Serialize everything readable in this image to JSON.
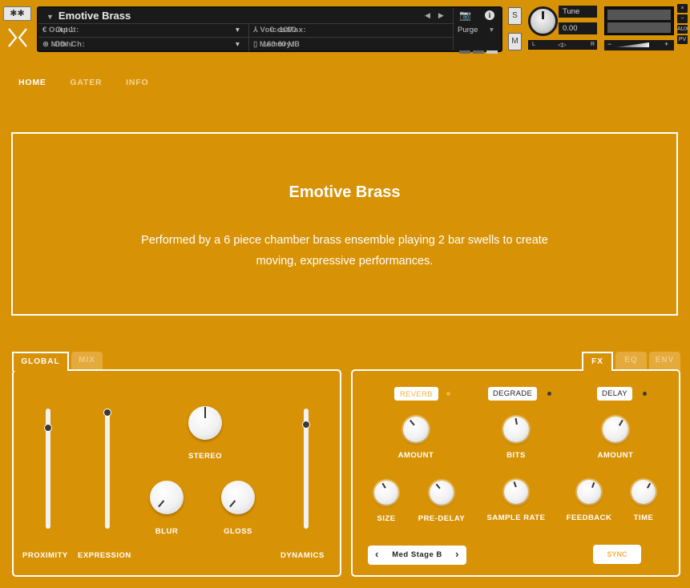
{
  "header": {
    "gear_glyph": "✱✱",
    "instrument_name": "Emotive Brass",
    "output_label": "Output:",
    "output_value": "Out 1",
    "midi_label": "MIDI Ch:",
    "midi_value": "Omni",
    "voices_label": "Voices:",
    "voices_value": "0",
    "max_label": "Max:",
    "max_value": "1000",
    "memory_label": "Memory:",
    "memory_value": "160.60 MB",
    "purge_label": "Purge",
    "solo_label": "S",
    "mute_label": "M",
    "tune_label": "Tune",
    "tune_value": "0.00",
    "pan_left": "L",
    "pan_center": "◁▷",
    "pan_right": "R",
    "vol_minus": "−",
    "vol_plus": "+",
    "side_close": "×",
    "side_min": "−",
    "side_aux": "AUX",
    "side_pv": "PV"
  },
  "nav": {
    "tabs": [
      {
        "label": "HOME",
        "active": true
      },
      {
        "label": "GATER",
        "active": false
      },
      {
        "label": "INFO",
        "active": false
      }
    ]
  },
  "info": {
    "title": "Emotive Brass",
    "description_line1": "Performed by a 6 piece chamber brass ensemble playing 2 bar swells to create",
    "description_line2": "moving, expressive performances."
  },
  "left_panel": {
    "tabs": [
      {
        "label": "GLOBAL",
        "active": true
      },
      {
        "label": "MIX",
        "active": false
      }
    ],
    "sliders": {
      "proximity": {
        "label": "PROXIMITY",
        "value": 0.84
      },
      "expression": {
        "label": "EXPRESSION",
        "value": 0.97
      },
      "dynamics": {
        "label": "DYNAMICS",
        "value": 0.87
      }
    },
    "knobs": {
      "stereo": {
        "label": "STEREO"
      },
      "blur": {
        "label": "BLUR"
      },
      "gloss": {
        "label": "GLOSS"
      }
    }
  },
  "right_panel": {
    "tabs": [
      {
        "label": "FX",
        "active": true
      },
      {
        "label": "EQ",
        "active": false
      },
      {
        "label": "ENV",
        "active": false
      }
    ],
    "modules": {
      "reverb": {
        "label": "REVERB",
        "enabled": false
      },
      "degrade": {
        "label": "DEGRADE",
        "enabled": true
      },
      "delay": {
        "label": "DELAY",
        "enabled": true
      }
    },
    "knob_labels": {
      "reverb_amount": "AMOUNT",
      "bits": "BITS",
      "delay_amount": "AMOUNT",
      "size": "SIZE",
      "pre_delay": "PRE-DELAY",
      "sample_rate": "SAMPLE RATE",
      "feedback": "FEEDBACK",
      "time": "TIME"
    },
    "reverb_preset": "Med Stage B",
    "prev_arrow": "‹",
    "next_arrow": "›",
    "sync_label": "SYNC"
  },
  "colors": {
    "background": "#d89205",
    "accent_light": "#f0b24a",
    "panel_dark": "#1a1a1a"
  }
}
